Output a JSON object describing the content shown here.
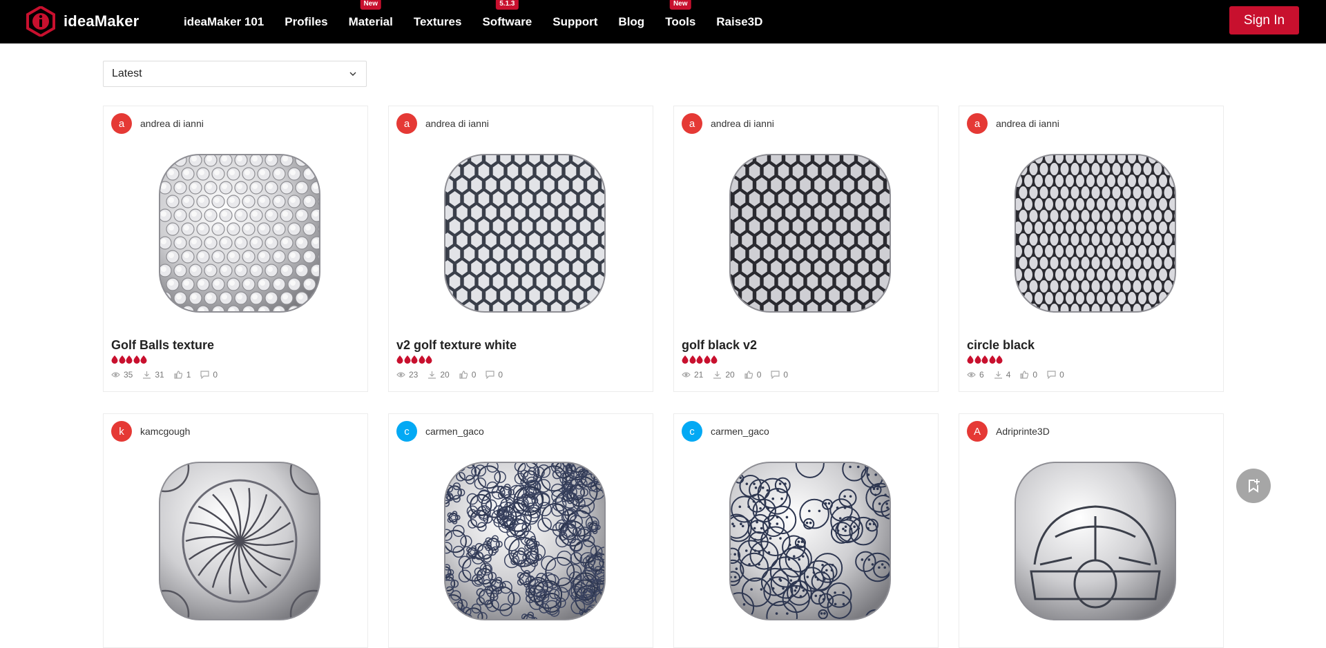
{
  "brand": {
    "name": "ideaMaker",
    "color": "#c8102e"
  },
  "nav": [
    {
      "label": "ideaMaker 101",
      "badge": ""
    },
    {
      "label": "Profiles",
      "badge": ""
    },
    {
      "label": "Material",
      "badge": "New"
    },
    {
      "label": "Textures",
      "badge": ""
    },
    {
      "label": "Software",
      "badge": "5.1.3"
    },
    {
      "label": "Support",
      "badge": ""
    },
    {
      "label": "Blog",
      "badge": ""
    },
    {
      "label": "Tools",
      "badge": "New"
    },
    {
      "label": "Raise3D",
      "badge": ""
    }
  ],
  "signin_label": "Sign In",
  "sort": {
    "selected": "Latest"
  },
  "cards": [
    {
      "user": "andrea di ianni",
      "initial": "a",
      "avatar_color": "#e53935",
      "title": "Golf Balls texture",
      "rating": 5,
      "views": "35",
      "downloads": "31",
      "likes": "1",
      "comments": "0",
      "pattern": "dimples"
    },
    {
      "user": "andrea di ianni",
      "initial": "a",
      "avatar_color": "#e53935",
      "title": "v2 golf texture white",
      "rating": 5,
      "views": "23",
      "downloads": "20",
      "likes": "0",
      "comments": "0",
      "pattern": "hex-light"
    },
    {
      "user": "andrea di ianni",
      "initial": "a",
      "avatar_color": "#e53935",
      "title": "golf black v2",
      "rating": 5,
      "views": "21",
      "downloads": "20",
      "likes": "0",
      "comments": "0",
      "pattern": "hex-dark"
    },
    {
      "user": "andrea di ianni",
      "initial": "a",
      "avatar_color": "#e53935",
      "title": "circle black",
      "rating": 5,
      "views": "6",
      "downloads": "4",
      "likes": "0",
      "comments": "0",
      "pattern": "ovals"
    },
    {
      "user": "kamcgough",
      "initial": "k",
      "avatar_color": "#e53935",
      "title": "",
      "rating": 0,
      "pattern": "flower"
    },
    {
      "user": "carmen_gaco",
      "initial": "c",
      "avatar_color": "#03a9f4",
      "title": "",
      "rating": 0,
      "pattern": "floral"
    },
    {
      "user": "carmen_gaco",
      "initial": "c",
      "avatar_color": "#03a9f4",
      "title": "",
      "rating": 0,
      "pattern": "doodle"
    },
    {
      "user": "Adriprinte3D",
      "initial": "A",
      "avatar_color": "#e53935",
      "title": "",
      "rating": 0,
      "pattern": "car"
    }
  ]
}
